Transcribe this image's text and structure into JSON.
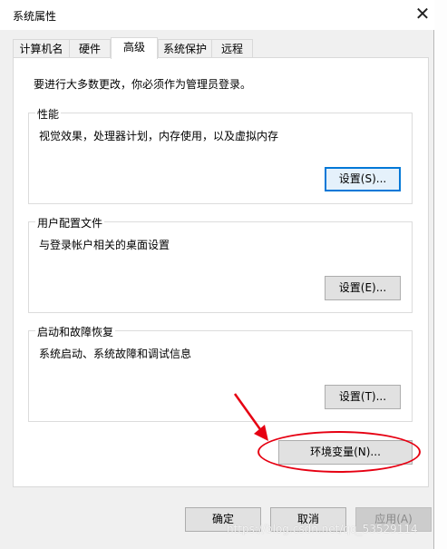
{
  "window": {
    "title": "系统属性",
    "close_glyph": "✕"
  },
  "tabs": [
    {
      "label": "计算机名"
    },
    {
      "label": "硬件"
    },
    {
      "label": "高级"
    },
    {
      "label": "系统保护"
    },
    {
      "label": "远程"
    }
  ],
  "active_tab": "高级",
  "intro": "要进行大多数更改，你必须作为管理员登录。",
  "groups": {
    "performance": {
      "title": "性能",
      "desc": "视觉效果，处理器计划，内存使用，以及虚拟内存",
      "button": "设置(S)..."
    },
    "user_profiles": {
      "title": "用户配置文件",
      "desc": "与登录帐户相关的桌面设置",
      "button": "设置(E)..."
    },
    "startup_recovery": {
      "title": "启动和故障恢复",
      "desc": "系统启动、系统故障和调试信息",
      "button": "设置(T)..."
    }
  },
  "env_button": "环境变量(N)...",
  "footer": {
    "ok": "确定",
    "cancel": "取消",
    "apply": "应用(A)"
  },
  "annotation": {
    "color": "#e60012"
  },
  "watermark": "https://blog.csdn.net/qq_53529114",
  "accent_color": "#0078d7"
}
